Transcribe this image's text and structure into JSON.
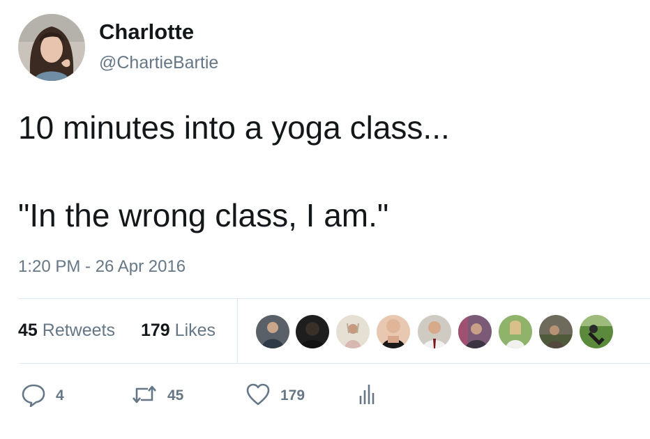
{
  "user": {
    "display_name": "Charlotte",
    "handle": "@ChartieBartie"
  },
  "tweet": {
    "line1": "10 minutes into a yoga class...",
    "line2": "\"In the wrong class, I am.\"",
    "timestamp": "1:20 PM - 26 Apr 2016"
  },
  "stats": {
    "retweets_count": "45",
    "retweets_label": "Retweets",
    "likes_count": "179",
    "likes_label": "Likes"
  },
  "likers_avatar_count": 9,
  "actions": {
    "reply_count": "4",
    "retweet_count": "45",
    "like_count": "179"
  },
  "colors": {
    "text": "#14171a",
    "secondary": "#657786",
    "divider": "#e1e8ed"
  },
  "icons": [
    "reply-icon",
    "retweet-icon",
    "heart-icon",
    "analytics-icon"
  ]
}
